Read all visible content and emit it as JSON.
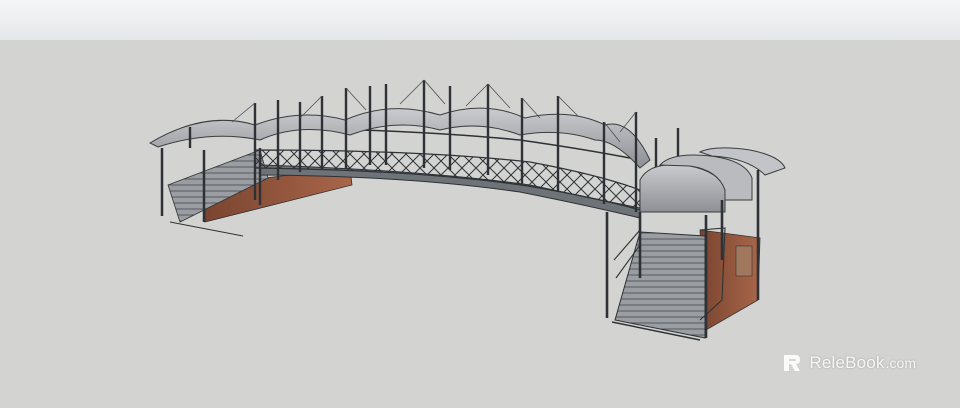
{
  "scene": {
    "sky_color": "#eef0f2",
    "ground_color": "#d3d3d1",
    "steel_color": "#2e3236",
    "canopy_color": "#a9abaf",
    "brick_color": "#9b5a3c",
    "stair_color": "#8d9296"
  },
  "watermark": {
    "brand": "ReleBook",
    "domain": ".com",
    "logo_icon": "relebook-logo-icon"
  }
}
